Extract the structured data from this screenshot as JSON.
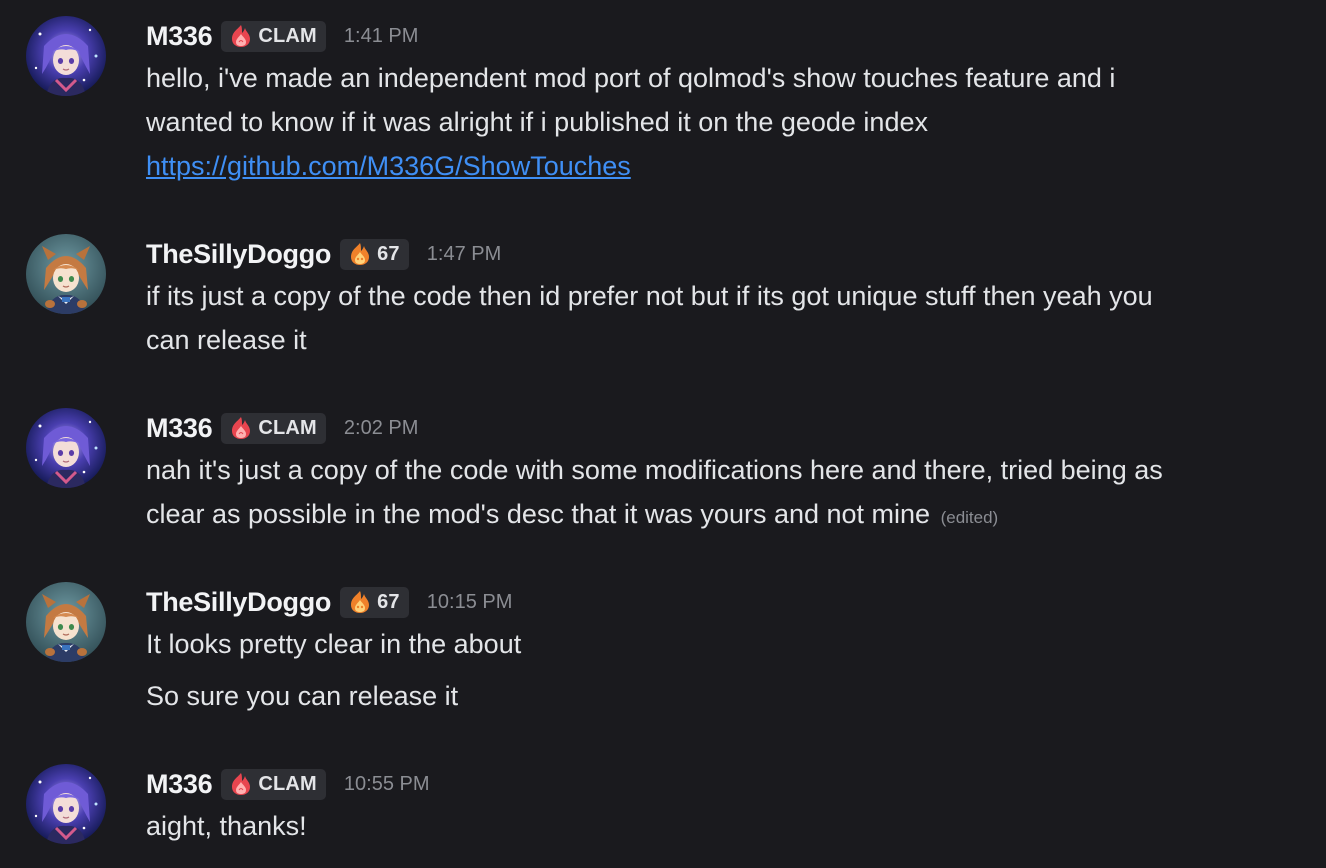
{
  "colors": {
    "background": "#1a1a1e",
    "username": "#f2f3f5",
    "text": "#e3e5e8",
    "timestamp": "#8b8d93",
    "link": "#3f8ff5",
    "tag_bg": "#2e2f34"
  },
  "messages": [
    {
      "author": "M336",
      "avatar_icon": "anime-girl-avatar-icon",
      "tag_icon": "clam-flame-icon",
      "tag": "CLAM",
      "time": "1:41 PM",
      "lines": [
        "hello, i've made an independent mod port of qolmod's show touches feature and i",
        "wanted to know if it was alright if i published it on the geode index"
      ],
      "link": "https://github.com/M336G/ShowTouches"
    },
    {
      "author": "TheSillyDoggo",
      "avatar_icon": "anime-dog-girl-avatar-icon",
      "tag_icon": "orange-flame-icon",
      "tag": "67",
      "time": "1:47 PM",
      "lines": [
        "if its just a copy of the code then id prefer not but if its got unique stuff then yeah you",
        "can release it"
      ]
    },
    {
      "author": "M336",
      "avatar_icon": "anime-girl-avatar-icon",
      "tag_icon": "clam-flame-icon",
      "tag": "CLAM",
      "time": "2:02 PM",
      "lines": [
        "nah it's just a copy of the code with some modifications here and there, tried being as",
        "clear as possible in the mod's desc that it was yours and not mine"
      ],
      "edited": "(edited)"
    },
    {
      "author": "TheSillyDoggo",
      "avatar_icon": "anime-dog-girl-avatar-icon",
      "tag_icon": "orange-flame-icon",
      "tag": "67",
      "time": "10:15 PM",
      "lines": [
        "It looks pretty clear in the about"
      ],
      "followup": "So sure you can release it"
    },
    {
      "author": "M336",
      "avatar_icon": "anime-girl-avatar-icon",
      "tag_icon": "clam-flame-icon",
      "tag": "CLAM",
      "time": "10:55 PM",
      "lines": [
        "aight, thanks!"
      ]
    }
  ]
}
